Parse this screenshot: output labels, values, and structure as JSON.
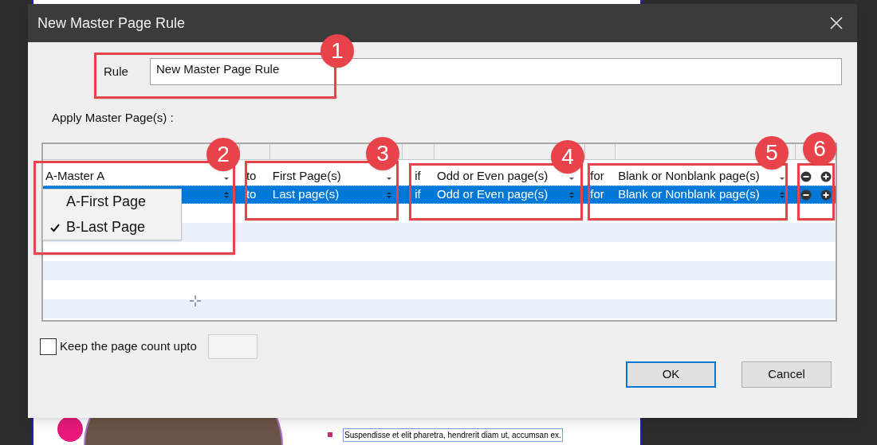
{
  "background_document": {
    "caption": "Suspendisse et elit pharetra, hendrerit diam ut, accumsan ex."
  },
  "window": {
    "title": "New Master Page Rule"
  },
  "rule": {
    "label": "Rule",
    "value": "New Master Page Rule"
  },
  "apply_label": "Apply Master Page(s) :",
  "rows": [
    {
      "selected": false,
      "master": "A-Master A",
      "to": "to",
      "pages": "First Page(s)",
      "if": "if",
      "parity": "Odd or Even page(s)",
      "for": "for",
      "blank": "Blank or Nonblank page(s)"
    },
    {
      "selected": true,
      "to": "to",
      "pages": "Last page(s)",
      "if": "if",
      "parity": "Odd or Even page(s)",
      "for": "for",
      "blank": "Blank or Nonblank page(s)"
    }
  ],
  "master_dropdown": [
    {
      "label": "A-First Page",
      "checked": false
    },
    {
      "label": "B-Last Page",
      "checked": true
    }
  ],
  "keep_count": {
    "label": "Keep the page count upto",
    "checked": false
  },
  "buttons": [
    {
      "label": "OK",
      "default": true
    },
    {
      "label": "Cancel",
      "default": false
    }
  ],
  "annotations": [
    "1",
    "2",
    "3",
    "4",
    "5",
    "6"
  ]
}
